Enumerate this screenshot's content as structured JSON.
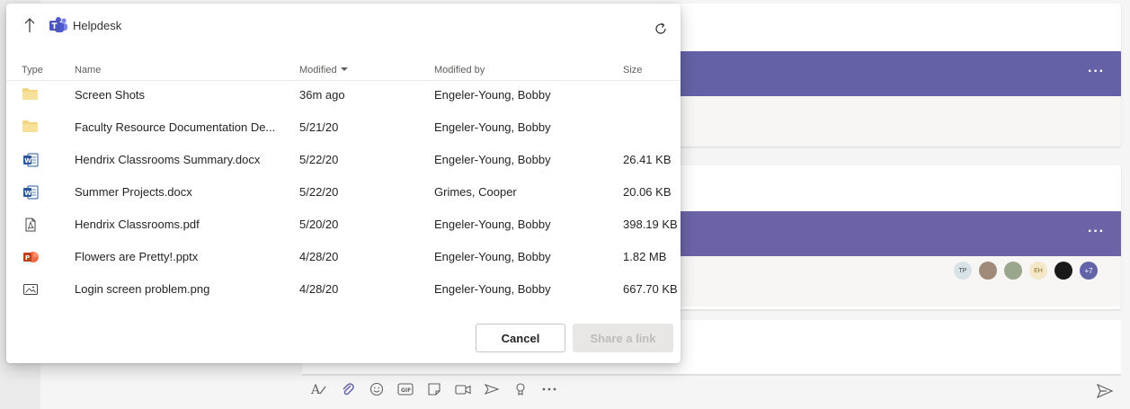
{
  "dialog": {
    "title": "Helpdesk",
    "columns": {
      "type": "Type",
      "name": "Name",
      "modified": "Modified",
      "modified_by": "Modified by",
      "size": "Size"
    },
    "files": [
      {
        "icon": "folder-icon",
        "name": "Screen Shots",
        "modified": "36m ago",
        "modified_by": "Engeler-Young, Bobby",
        "size": ""
      },
      {
        "icon": "folder-icon",
        "name": "Faculty Resource Documentation De...",
        "modified": "5/21/20",
        "modified_by": "Engeler-Young, Bobby",
        "size": ""
      },
      {
        "icon": "word-icon",
        "name": "Hendrix Classrooms Summary.docx",
        "modified": "5/22/20",
        "modified_by": "Engeler-Young, Bobby",
        "size": "26.41 KB"
      },
      {
        "icon": "word-icon",
        "name": "Summer Projects.docx",
        "modified": "5/22/20",
        "modified_by": "Grimes, Cooper",
        "size": "20.06 KB"
      },
      {
        "icon": "pdf-icon",
        "name": "Hendrix Classrooms.pdf",
        "modified": "5/20/20",
        "modified_by": "Engeler-Young, Bobby",
        "size": "398.19 KB"
      },
      {
        "icon": "powerpoint-icon",
        "name": "Flowers are Pretty!.pptx",
        "modified": "4/28/20",
        "modified_by": "Engeler-Young, Bobby",
        "size": "1.82 MB"
      },
      {
        "icon": "image-icon",
        "name": "Login screen problem.png",
        "modified": "4/28/20",
        "modified_by": "Engeler-Young, Bobby",
        "size": "667.70 KB"
      }
    ],
    "buttons": {
      "cancel": "Cancel",
      "share": "Share a link"
    }
  },
  "background": {
    "avatars": [
      "TP",
      "",
      "",
      "EH",
      "",
      "+7"
    ],
    "accent_color": "#6264a7"
  }
}
